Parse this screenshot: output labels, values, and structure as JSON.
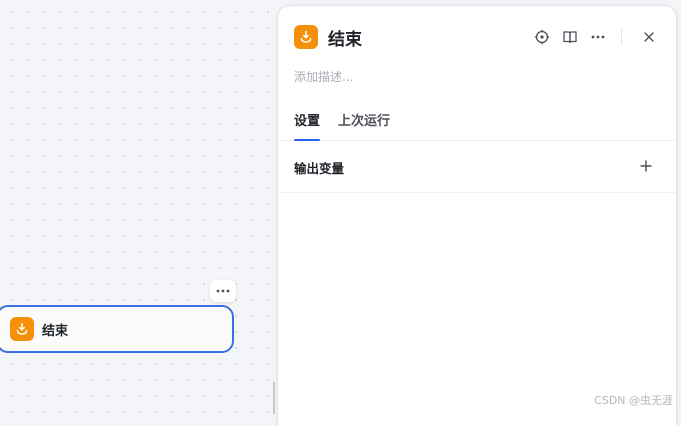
{
  "canvas": {
    "node": {
      "title": "结束",
      "icon": "end-node-icon"
    },
    "more_icon": "more-dots-icon"
  },
  "panel": {
    "title": "结束",
    "icon": "end-node-icon",
    "description_placeholder": "添加描述...",
    "actions": [
      "locate-icon",
      "book-icon",
      "more-dots-icon",
      "close-icon"
    ],
    "tabs": [
      {
        "label": "设置",
        "active": true
      },
      {
        "label": "上次运行",
        "active": false
      }
    ],
    "section": {
      "title": "输出变量",
      "add_icon": "plus-icon"
    }
  },
  "watermark": "CSDN @虫无涯",
  "colors": {
    "accent": "#2563eb",
    "node_icon": "#f79009",
    "selected_border": "#3a6fe0"
  }
}
